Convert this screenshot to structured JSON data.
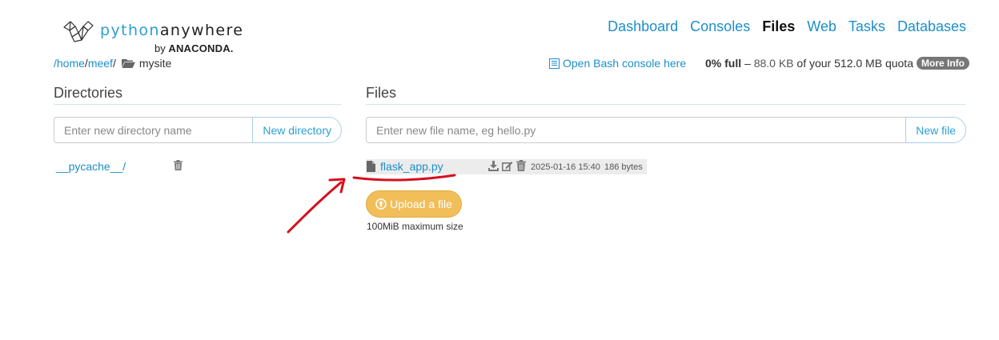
{
  "brand": {
    "name_part1": "python",
    "name_part2": "anywhere",
    "by": "by",
    "company": "ANACONDA",
    "company_suffix": "."
  },
  "nav": [
    {
      "label": "Dashboard",
      "active": false
    },
    {
      "label": "Consoles",
      "active": false
    },
    {
      "label": "Files",
      "active": true
    },
    {
      "label": "Web",
      "active": false
    },
    {
      "label": "Tasks",
      "active": false
    },
    {
      "label": "Databases",
      "active": false
    }
  ],
  "breadcrumb": {
    "root": "/home",
    "sep1": "/",
    "user": "meef",
    "sep2": "/",
    "current": "mysite"
  },
  "bash_link": "Open Bash console here",
  "quota": {
    "percent": "0% full",
    "dash": "–",
    "used": "88.0 KB",
    "mid": "of your",
    "total": "512.0 MB",
    "suffix": "quota",
    "more_info": "More Info"
  },
  "directories": {
    "title": "Directories",
    "input_placeholder": "Enter new directory name",
    "button": "New directory",
    "items": [
      {
        "name": "__pycache__/"
      }
    ]
  },
  "files": {
    "title": "Files",
    "input_placeholder": "Enter new file name, eg hello.py",
    "button": "New file",
    "items": [
      {
        "name": "flask_app.py",
        "modified": "2025-01-16 15:40",
        "size": "186 bytes"
      }
    ]
  },
  "upload": {
    "button": "Upload a file",
    "note": "100MiB maximum size"
  },
  "colors": {
    "link": "#1d8fc7",
    "upload_button": "#f1be5a",
    "annotation": "#d4101d"
  },
  "icons": [
    "snake-logo-icon",
    "folder-open-icon",
    "console-icon",
    "trash-icon",
    "file-icon",
    "download-icon",
    "edit-icon",
    "upload-circle-icon"
  ]
}
